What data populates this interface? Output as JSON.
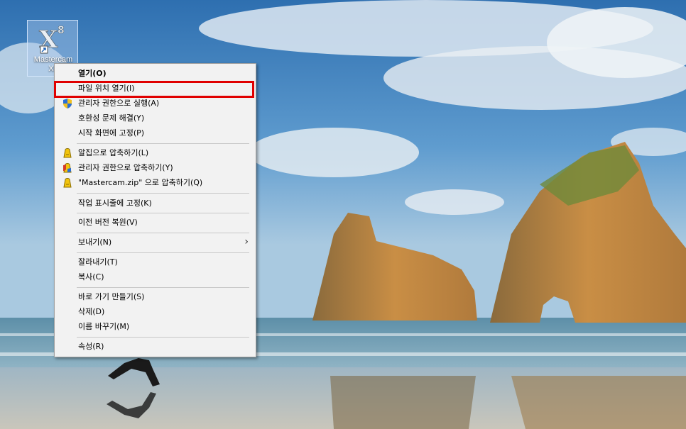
{
  "desktop": {
    "icon": {
      "name": "Mastercam X8",
      "label_line1": "Mastercam",
      "label_line2": "X8",
      "icon": "mastercam-x8-icon"
    }
  },
  "context_menu": {
    "items": [
      {
        "label": "열기(O)",
        "bold": true
      },
      {
        "label": "파일 위치 열기(I)",
        "highlighted": true
      },
      {
        "label": "관리자 권한으로 실행(A)",
        "icon": "uac-shield-icon"
      },
      {
        "label": "호환성 문제 해결(Y)"
      },
      {
        "label": "시작 화면에 고정(P)"
      },
      {
        "label": "알집으로 압축하기(L)",
        "icon": "alzip-icon"
      },
      {
        "label": "관리자 권한으로 압축하기(Y)",
        "icon": "alzip-admin-icon"
      },
      {
        "label": "\"Mastercam.zip\" 으로 압축하기(Q)",
        "icon": "alzip-icon"
      },
      {
        "label": "작업 표시줄에 고정(K)"
      },
      {
        "label": "이전 버전 복원(V)"
      },
      {
        "label": "보내기(N)",
        "submenu": true,
        "icon": "chevron-right-icon"
      },
      {
        "label": "잘라내기(T)"
      },
      {
        "label": "복사(C)"
      },
      {
        "label": "바로 가기 만들기(S)"
      },
      {
        "label": "삭제(D)"
      },
      {
        "label": "이름 바꾸기(M)"
      },
      {
        "label": "속성(R)"
      }
    ],
    "submenu_arrow": "›"
  },
  "colors": {
    "highlight_border": "#e00000",
    "menu_bg": "#f2f2f2"
  }
}
